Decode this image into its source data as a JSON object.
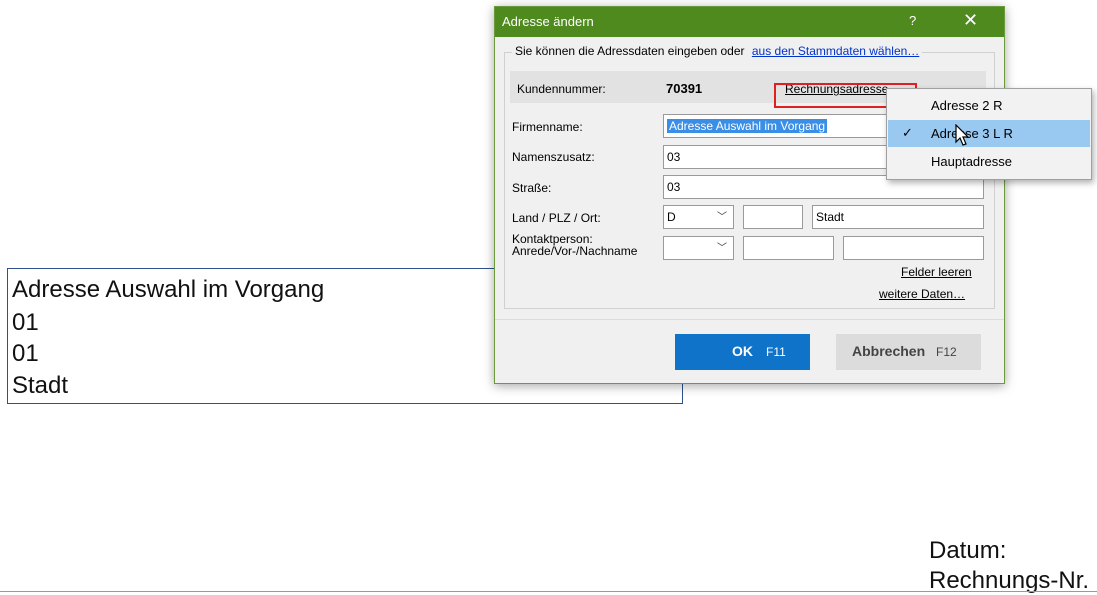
{
  "document": {
    "address_lines": [
      "Adresse Auswahl im Vorgang",
      "01",
      "01",
      "Stadt"
    ],
    "datum_label": "Datum:",
    "rechnung_label": "Rechnungs-Nr."
  },
  "dialog": {
    "title": "Adresse ändern",
    "help": "?",
    "close": "✕",
    "intro_text": "Sie können die Adressdaten eingeben oder",
    "intro_link": "aus den Stammdaten wählen…",
    "kundennummer_label": "Kundennummer:",
    "kundennummer_value": "70391",
    "address_type_link": "Rechnungsadresse",
    "firmenname_label": "Firmenname:",
    "firmenname_value": "Adresse Auswahl im Vorgang",
    "namenszusatz_label": "Namenszusatz:",
    "namenszusatz_value": "03",
    "strasse_label": "Straße:",
    "strasse_value": "03",
    "land_label": "Land / PLZ / Ort:",
    "land_value": "D",
    "plz_value": "",
    "ort_value": "Stadt",
    "kontakt_label_1": "Kontaktperson:",
    "kontakt_label_2": "Anrede/Vor-/Nachname",
    "anrede_value": "",
    "vorname_value": "",
    "nachname_value": "",
    "felder_leeren": "Felder leeren",
    "weitere_daten": "weitere Daten…",
    "ok_label": "OK",
    "ok_key": "F11",
    "cancel_label": "Abbrechen",
    "cancel_key": "F12"
  },
  "menu": {
    "items": [
      {
        "label": "Adresse 2 R",
        "checked": false
      },
      {
        "label": "Adresse 3 L R",
        "checked": true
      },
      {
        "label": "Hauptadresse",
        "checked": false
      }
    ],
    "check_glyph": "✓"
  },
  "colors": {
    "titlebar": "#4f8a1f",
    "ok_button": "#0f73c9",
    "menu_highlight": "#99c9f0",
    "highlight_box": "#e02020"
  }
}
